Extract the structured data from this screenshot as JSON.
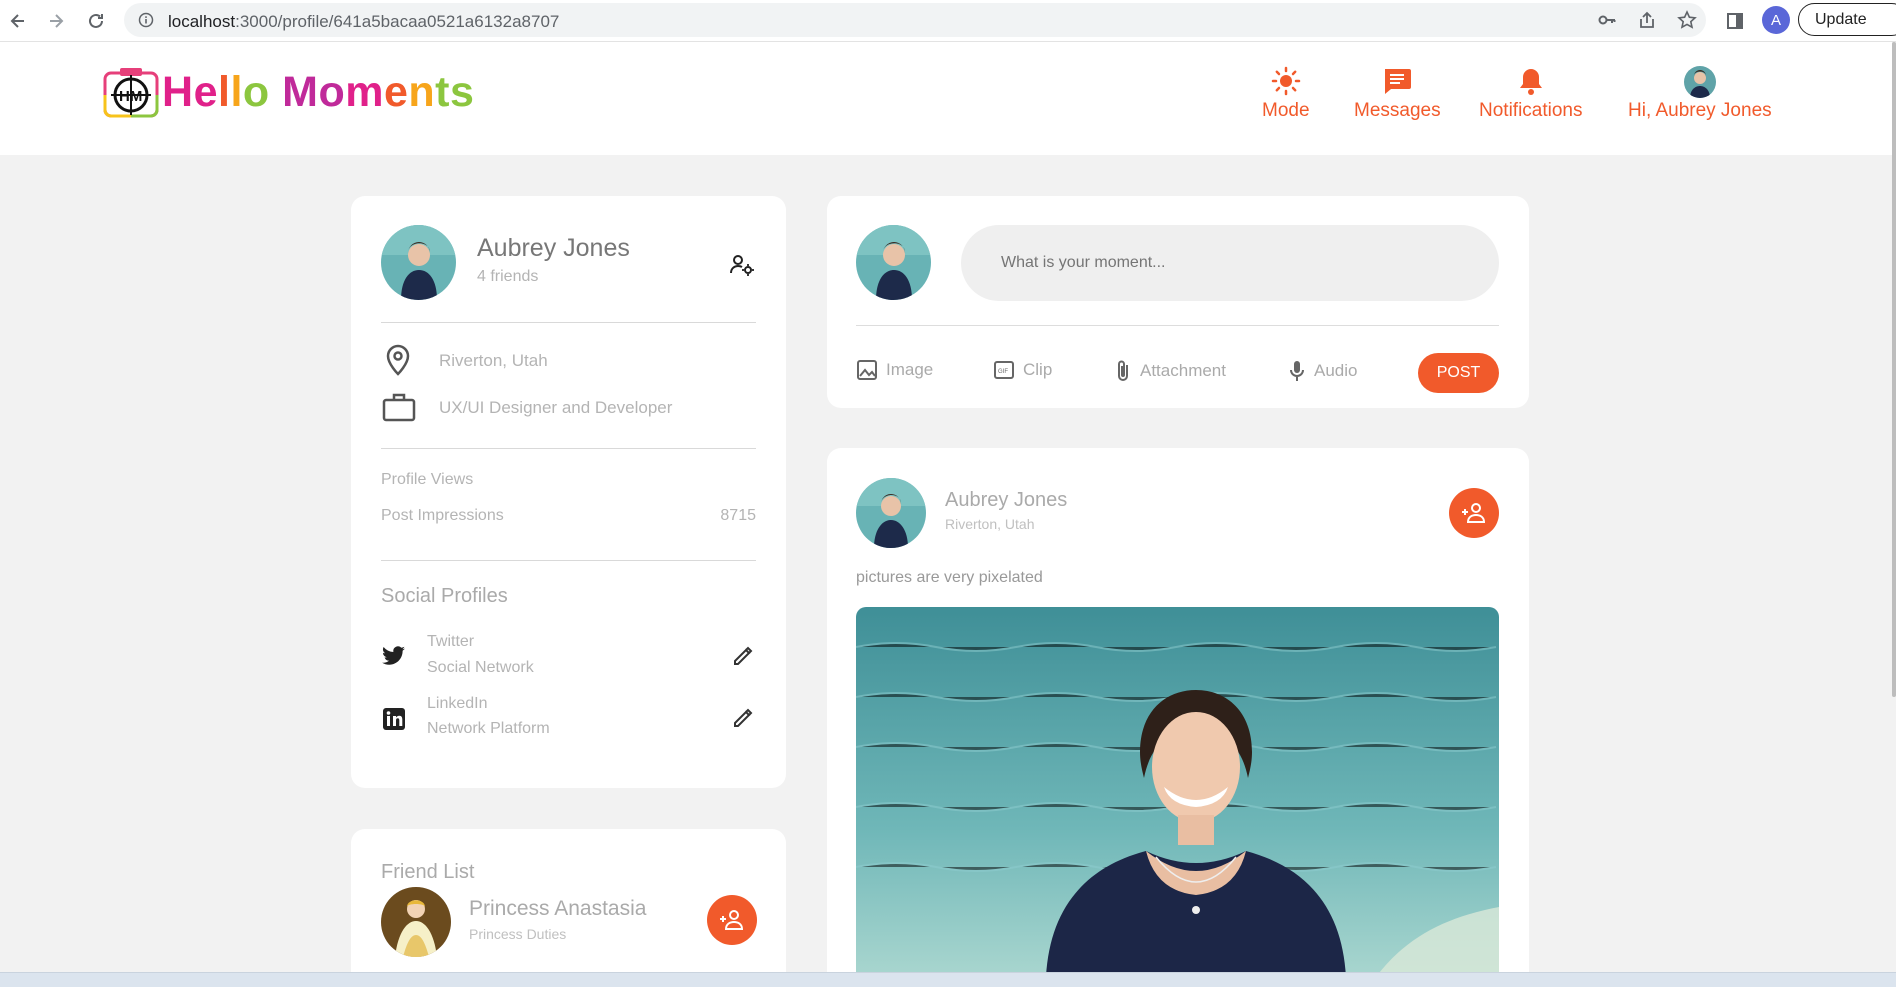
{
  "browser": {
    "url_host": "localhost",
    "url_path": ":3000/profile/641a5bacaa0521a6132a8707",
    "profile_initial": "A",
    "update_label": "Update"
  },
  "header": {
    "logo_text_parts": [
      "H",
      "e",
      "l",
      "l",
      "o",
      " ",
      "M",
      "o",
      "m",
      "e",
      "n",
      "t",
      "s"
    ],
    "nav": {
      "mode": "Mode",
      "messages": "Messages",
      "notifications": "Notifications",
      "user": "Hi, Aubrey Jones"
    }
  },
  "profile": {
    "name": "Aubrey Jones",
    "friends": "4 friends",
    "location": "Riverton, Utah",
    "occupation": "UX/UI Designer and Developer",
    "stats": {
      "views_label": "Profile Views",
      "views_value": "",
      "impressions_label": "Post Impressions",
      "impressions_value": "8715"
    },
    "social_title": "Social Profiles",
    "social": [
      {
        "name": "Twitter",
        "sub": "Social Network"
      },
      {
        "name": "LinkedIn",
        "sub": "Network Platform"
      }
    ]
  },
  "friends": {
    "title": "Friend List",
    "items": [
      {
        "name": "Princess Anastasia",
        "sub": "Princess Duties"
      }
    ]
  },
  "composer": {
    "placeholder": "What is your moment...",
    "image": "Image",
    "clip": "Clip",
    "attachment": "Attachment",
    "audio": "Audio",
    "post": "POST"
  },
  "post": {
    "author": "Aubrey Jones",
    "location": "Riverton, Utah",
    "text": "pictures are very pixelated"
  },
  "colors": {
    "accent": "#f15a2b",
    "card": "#ffffff",
    "background": "#f2f2f2"
  }
}
